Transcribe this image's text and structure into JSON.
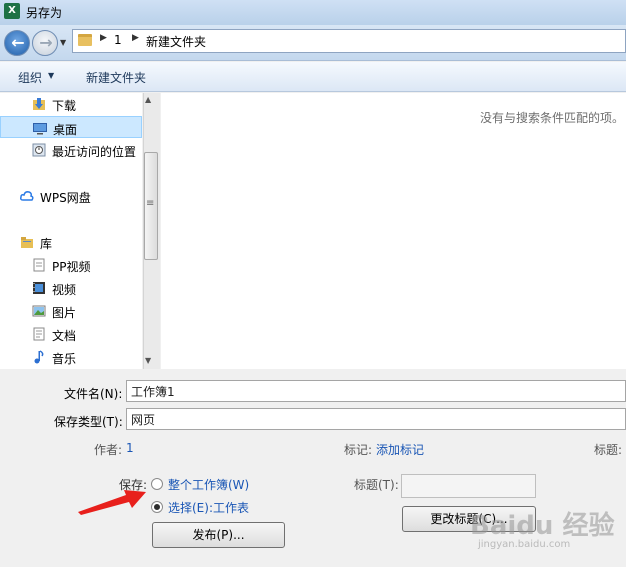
{
  "window": {
    "title": "另存为",
    "app_icon_text": "X"
  },
  "breadcrumb": {
    "items": [
      "1",
      "新建文件夹"
    ]
  },
  "toolbar": {
    "organize_label": "组织",
    "new_folder_label": "新建文件夹"
  },
  "nav_pane": {
    "items": [
      {
        "label": "下载",
        "icon": "downloads-icon"
      },
      {
        "label": "桌面",
        "icon": "desktop-icon",
        "selected": true
      },
      {
        "label": "最近访问的位置",
        "icon": "recent-places-icon"
      },
      {
        "label": "WPS网盘",
        "icon": "cloud-icon"
      },
      {
        "label": "库",
        "icon": "library-icon"
      },
      {
        "label": "PP视频",
        "icon": "document-icon"
      },
      {
        "label": "视频",
        "icon": "video-icon"
      },
      {
        "label": "图片",
        "icon": "picture-icon"
      },
      {
        "label": "文档",
        "icon": "document-icon"
      },
      {
        "label": "音乐",
        "icon": "music-icon"
      }
    ]
  },
  "file_list": {
    "empty_message": "没有与搜索条件匹配的项。"
  },
  "form": {
    "filename_label": "文件名(N):",
    "filename_value": "工作簿1",
    "filetype_label": "保存类型(T):",
    "filetype_value": "网页",
    "author_label": "作者:",
    "author_value": "1",
    "tags_label": "标记:",
    "tags_value": "添加标记",
    "title_meta_label": "标题:",
    "save_label": "保存:",
    "option_entire_workbook": "整个工作簿(W)",
    "option_selection": "选择(E):工作表",
    "selected_option": "selection",
    "publish_button": "发布(P)...",
    "title_field_label": "标题(T):",
    "change_title_button": "更改标题(C)..."
  },
  "watermark": {
    "text": "Baidu 经验",
    "sub": "jingyan.baidu.com"
  },
  "colors": {
    "accent_link": "#1a56b5",
    "annotation_arrow": "#e8201c",
    "selected_bg": "#cce8ff"
  }
}
